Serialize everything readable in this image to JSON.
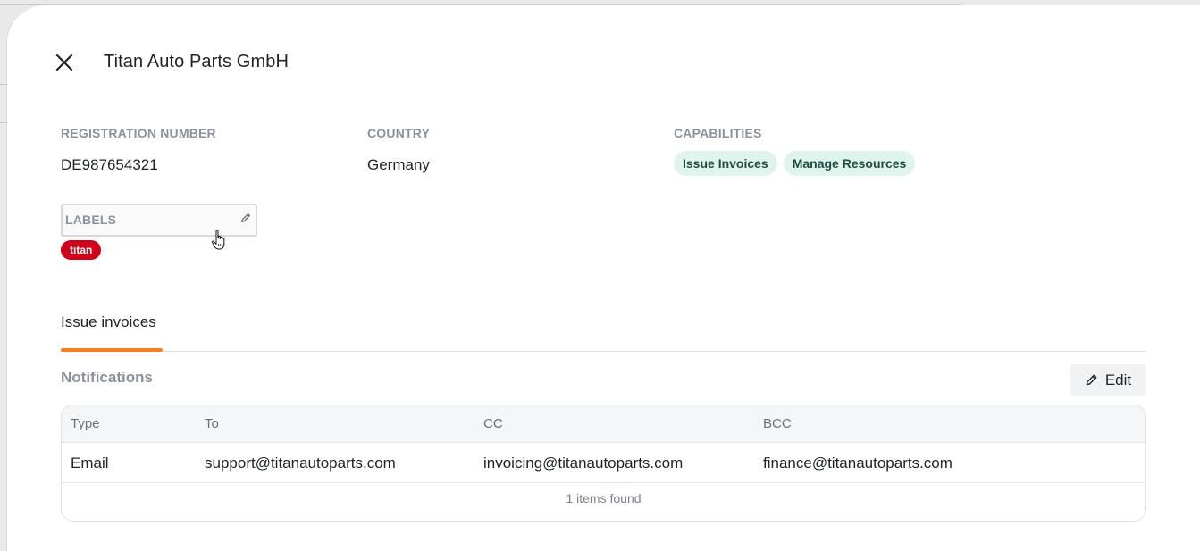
{
  "dialog": {
    "title": "Titan Auto Parts GmbH"
  },
  "fields": {
    "registration_label": "REGISTRATION NUMBER",
    "registration_value": "DE987654321",
    "country_label": "COUNTRY",
    "country_value": "Germany",
    "capabilities_label": "CAPABILITIES",
    "capabilities": [
      "Issue Invoices",
      "Manage Resources"
    ],
    "labels_label": "LABELS",
    "labels": [
      "titan"
    ]
  },
  "tabs": [
    {
      "label": "Issue invoices",
      "active": true
    }
  ],
  "notifications": {
    "title": "Notifications",
    "edit_label": "Edit",
    "columns": [
      "Type",
      "To",
      "CC",
      "BCC"
    ],
    "rows": [
      {
        "type": "Email",
        "to": "support@titanautoparts.com",
        "cc": "invoicing@titanautoparts.com",
        "bcc": "finance@titanautoparts.com"
      }
    ],
    "footer": "1 items found"
  },
  "colors": {
    "accent_tab": "#f08022",
    "label_tag": "#d0021b",
    "capability_badge_bg": "#dff4ec",
    "capability_badge_text": "#1e4d42"
  },
  "icons": {
    "close": "close-icon",
    "label_edit": "pencil-icon",
    "edit_button": "pencil-icon",
    "cursor": "hand-pointer-icon"
  }
}
